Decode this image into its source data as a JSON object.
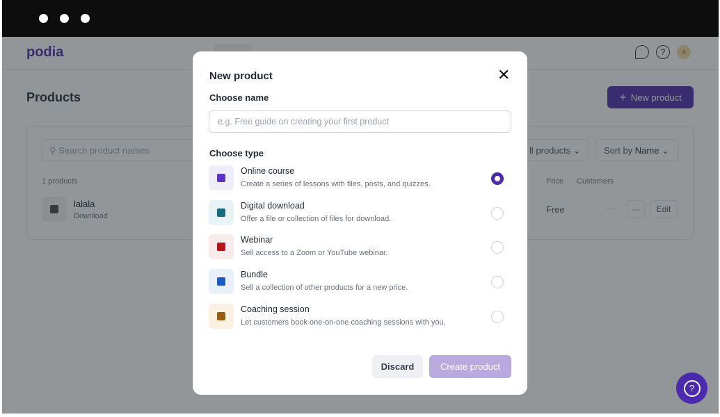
{
  "app": {
    "logo": "podia",
    "page_title": "Products",
    "new_product_label": "New product",
    "avatar_initial": "A"
  },
  "products": {
    "search_placeholder": "Search product names",
    "filter_label": "ll products",
    "sort_prefix": "Sort by ",
    "sort_value": "Name",
    "count": "1 products",
    "columns": {
      "price": "Price",
      "customers": "Customers"
    },
    "rows": [
      {
        "name": "lalala",
        "type": "Download",
        "price": "Free",
        "customers": "—",
        "more": "···",
        "edit": "Edit"
      }
    ]
  },
  "modal": {
    "title": "New product",
    "name_label": "Choose name",
    "name_placeholder": "e.g. Free guide on creating your first product",
    "type_label": "Choose type",
    "options": [
      {
        "name": "Online course",
        "desc": "Create a series of lessons with files, posts, and quizzes.",
        "selected": true,
        "bg": "#f0edfb",
        "fg": "#5b34c7"
      },
      {
        "name": "Digital download",
        "desc": "Offer a file or collection of files for download.",
        "selected": false,
        "bg": "#e8f3f5",
        "fg": "#176a80"
      },
      {
        "name": "Webinar",
        "desc": "Sell access to a Zoom or YouTube webinar.",
        "selected": false,
        "bg": "#f9ebeb",
        "fg": "#b3151b"
      },
      {
        "name": "Bundle",
        "desc": "Sell a collection of other products for a new price.",
        "selected": false,
        "bg": "#e9f0f9",
        "fg": "#1e5bc0"
      },
      {
        "name": "Coaching session",
        "desc": "Let customers book one-on-one coaching sessions with you.",
        "selected": false,
        "bg": "#fbf1e2",
        "fg": "#9a5b12"
      }
    ],
    "discard": "Discard",
    "create": "Create product"
  },
  "colors": {
    "accent": "#4b2aad",
    "accent_disabled": "#b8a9df"
  }
}
